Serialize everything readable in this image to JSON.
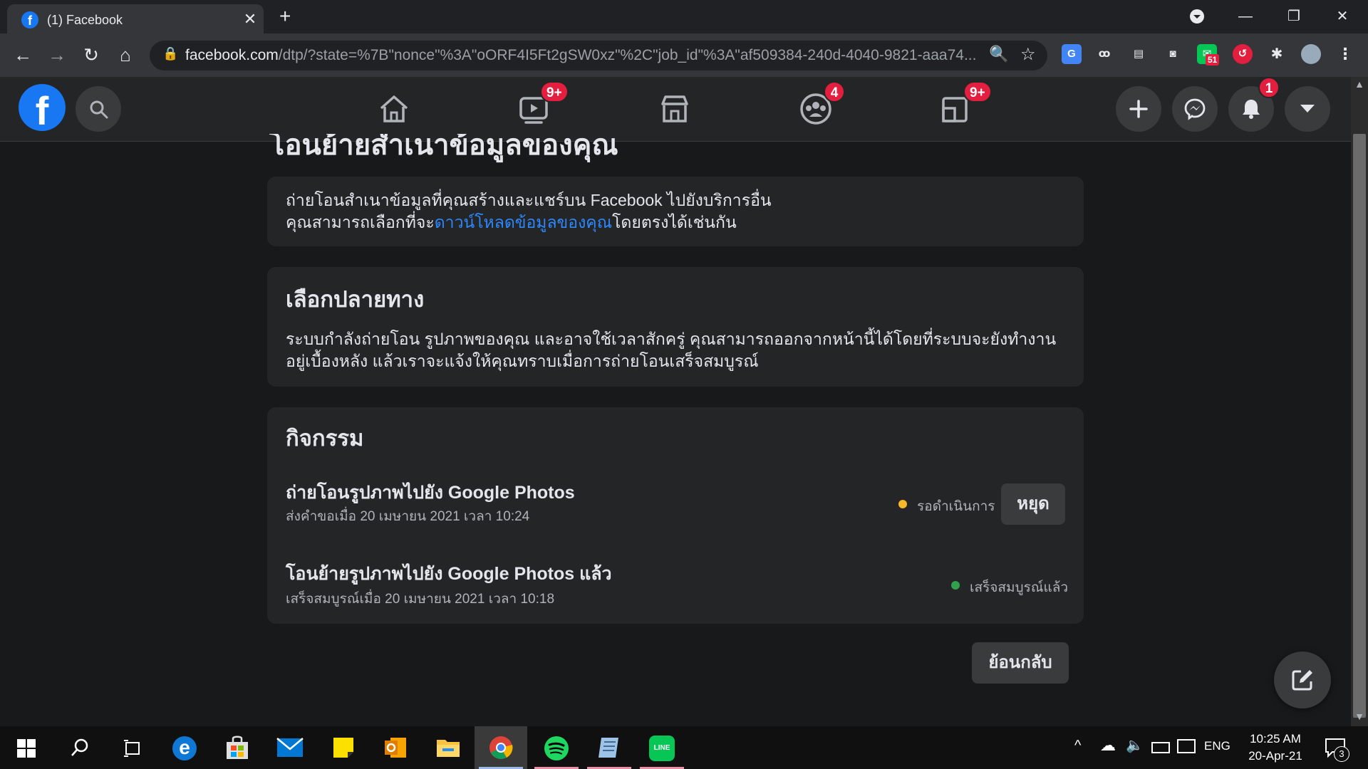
{
  "browser": {
    "tab_title": "(1) Facebook",
    "url_host": "facebook.com",
    "url_rest": "/dtp/?state=%7B\"nonce\"%3A\"oORF4I5Ft2gSW0xz\"%2C\"job_id\"%3A\"af509384-240d-4040-9821-aaa74...",
    "extension_badge": "51"
  },
  "fb_header": {
    "watch_badge": "9+",
    "groups_badge": "4",
    "gaming_badge": "9+",
    "notifications_badge": "1"
  },
  "page": {
    "title": "โอนย้ายสำเนาข้อมูลของคุณ",
    "intro": {
      "line1": "ถ่ายโอนสำเนาข้อมูลที่คุณสร้างและแชร์บน Facebook ไปยังบริการอื่น",
      "line2_pre": "คุณสามารถเลือกที่จะ",
      "line2_link": "ดาวน์โหลดข้อมูลของคุณ",
      "line2_post": "โดยตรงได้เช่นกัน"
    },
    "destination": {
      "heading": "เลือกปลายทาง",
      "line1": "ระบบกำลังถ่ายโอน รูปภาพของคุณ และอาจใช้เวลาสักครู่ คุณสามารถออกจากหน้านี้ได้โดยที่ระบบจะยังทำงาน",
      "line2": "อยู่เบื้องหลัง แล้วเราจะแจ้งให้คุณทราบเมื่อการถ่ายโอนเสร็จสมบูรณ์"
    },
    "activity": {
      "heading": "กิจกรรม",
      "items": [
        {
          "title": "ถ่ายโอนรูปภาพไปยัง Google Photos",
          "subtitle": "ส่งคำขอเมื่อ 20 เมษายน 2021 เวลา 10:24",
          "status": "รอดำเนินการ",
          "status_color": "#f7b928",
          "action": "หยุด"
        },
        {
          "title": "โอนย้ายรูปภาพไปยัง Google Photos แล้ว",
          "subtitle": "เสร็จสมบูรณ์เมื่อ 20 เมษายน 2021 เวลา 10:18",
          "status": "เสร็จสมบูรณ์แล้ว",
          "status_color": "#31a24c"
        }
      ]
    },
    "back_button": "ย้อนกลับ"
  },
  "taskbar": {
    "language": "ENG",
    "time": "10:25 AM",
    "date": "20-Apr-21",
    "notification_count": "3"
  },
  "colors": {
    "accent": "#1877f2",
    "link": "#2d88ff",
    "badge": "#e41e3f"
  }
}
